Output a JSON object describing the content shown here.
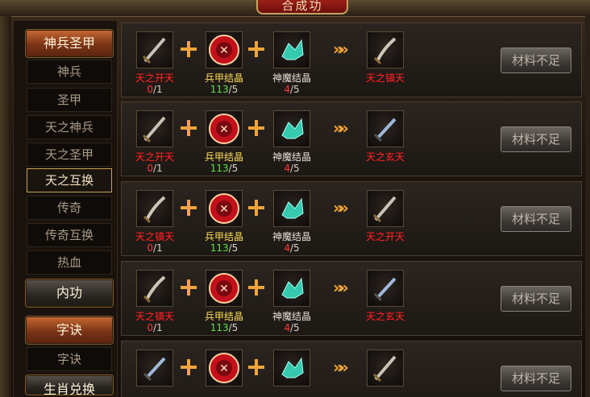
{
  "title": "合成功",
  "sidebar": {
    "cat1": "神兵圣甲",
    "items": [
      "神兵",
      "圣甲",
      "天之神兵",
      "天之圣甲",
      "天之互换",
      "传奇",
      "传奇互换",
      "热血"
    ],
    "cat2": "内功",
    "cat3": "字诀",
    "sub_zijue": "字诀",
    "cat4": "生肖兑换"
  },
  "rows": [
    {
      "in1_name": "天之开天",
      "in1_have": "0",
      "in1_need": "/1",
      "in2_name": "兵甲结晶",
      "in2_have": "113",
      "in2_need": "/5",
      "in3_name": "神魔结晶",
      "in3_have": "4",
      "in3_need": "/5",
      "out_name": "天之镇天",
      "button": "材料不足"
    },
    {
      "in1_name": "天之开天",
      "in1_have": "0",
      "in1_need": "/1",
      "in2_name": "兵甲结晶",
      "in2_have": "113",
      "in2_need": "/5",
      "in3_name": "神魔结晶",
      "in3_have": "4",
      "in3_need": "/5",
      "out_name": "天之玄天",
      "button": "材料不足"
    },
    {
      "in1_name": "天之镇天",
      "in1_have": "0",
      "in1_need": "/1",
      "in2_name": "兵甲结晶",
      "in2_have": "113",
      "in2_need": "/5",
      "in3_name": "神魔结晶",
      "in3_have": "4",
      "in3_need": "/5",
      "out_name": "天之开天",
      "button": "材料不足"
    },
    {
      "in1_name": "天之镇天",
      "in1_have": "0",
      "in1_need": "/1",
      "in2_name": "兵甲结晶",
      "in2_have": "113",
      "in2_need": "/5",
      "in3_name": "神魔结晶",
      "in3_have": "4",
      "in3_need": "/5",
      "out_name": "天之玄天",
      "button": "材料不足"
    },
    {
      "button": "材料不足"
    }
  ],
  "arrow": "»»",
  "colors": {
    "accent": "#f0a53a",
    "red_text": "#ff2a2a",
    "green_count": "#5fe14a"
  }
}
